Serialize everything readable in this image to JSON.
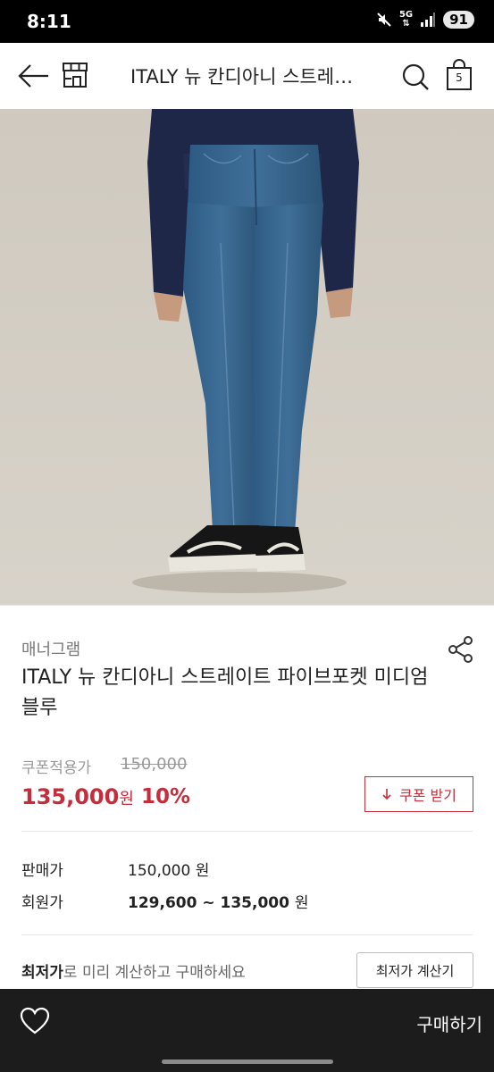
{
  "status_bar": {
    "time": "8:11",
    "network": "5G",
    "battery": "91"
  },
  "header": {
    "title": "ITALY 뉴 칸디아니 스트레이트 파이브포켓 미디엄블루",
    "cart_count": "5",
    "icons": [
      "back-arrow-icon",
      "store-icon",
      "search-icon",
      "shopping-bag-icon"
    ]
  },
  "product": {
    "image_alt": "jeans-product-photo",
    "brand": "매너그램",
    "name": "ITALY 뉴 칸디아니 스트레이트 파이브포켓 미디엄블루"
  },
  "pricing": {
    "coupon_label": "쿠폰적용가",
    "original_price": "150,000",
    "sale_price": "135,000",
    "sale_unit": "원",
    "discount_rate": "10%",
    "coupon_button_label": "쿠폰 받기",
    "accent_color": "#c62c3a"
  },
  "price_info": {
    "sale_label": "판매가",
    "sale_value": "150,000 원",
    "member_label": "회원가",
    "member_value": "129,600 ~ 135,000",
    "member_unit": "원"
  },
  "lowest_price": {
    "strong_text": "최저가",
    "rest_text": "로 미리 계산하고 구매하세요",
    "button_label": "최저가 계산기"
  },
  "bottom_bar": {
    "buy_label": "구매하기",
    "background": "#1c1c1c"
  }
}
